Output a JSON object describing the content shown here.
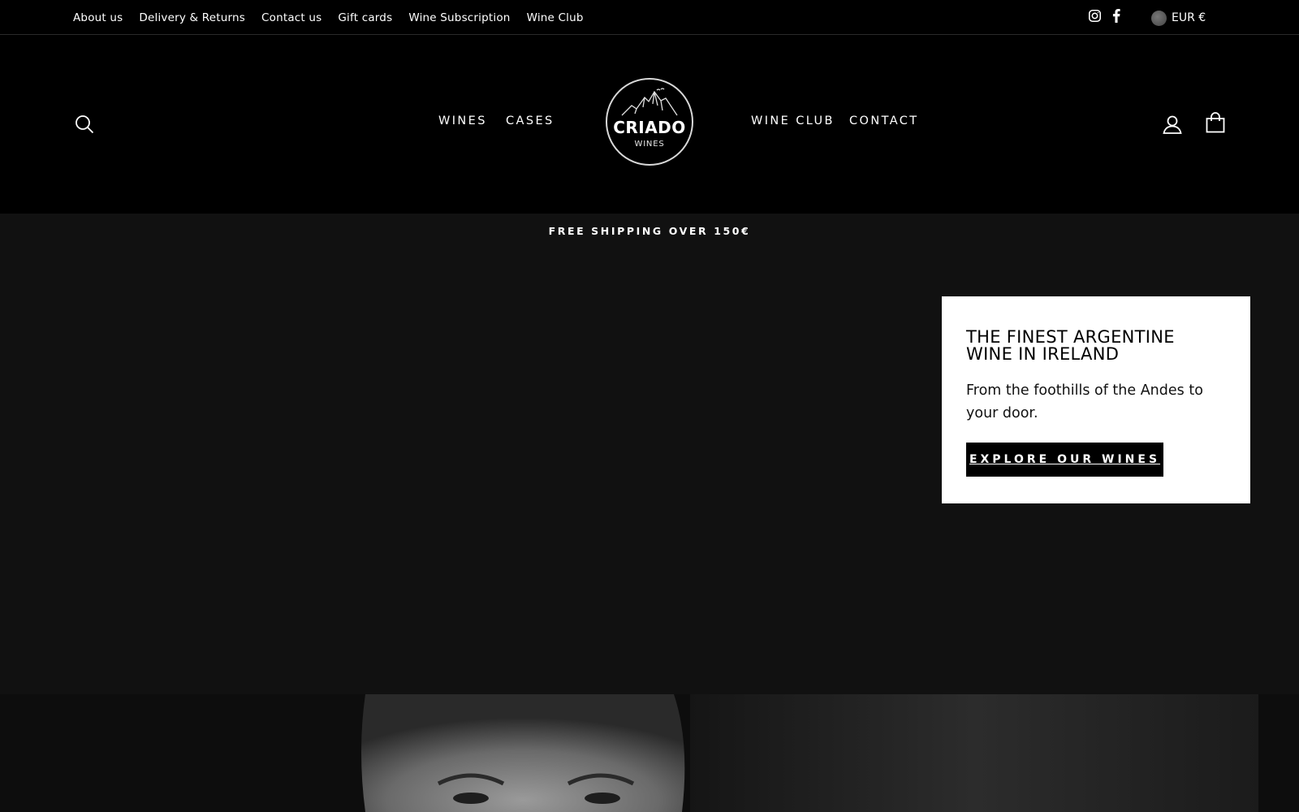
{
  "topbar": {
    "links": [
      "About us",
      "Delivery & Returns",
      "Contact us",
      "Gift cards",
      "Wine Subscription",
      "Wine Club"
    ],
    "social": [
      "instagram-icon",
      "facebook-icon"
    ],
    "currency": "EUR €"
  },
  "header": {
    "nav_left": [
      "WINES",
      "CASES"
    ],
    "nav_right": [
      "WINE CLUB",
      "CONTACT"
    ],
    "logo": {
      "title": "CRIADO",
      "subtitle": "WINES"
    },
    "icons": [
      "search-icon",
      "account-icon",
      "cart-icon"
    ]
  },
  "announcement": {
    "text": "FREE SHIPPING OVER 150€"
  },
  "promo": {
    "title": "THE FINEST ARGENTINE WINE IN IRELAND",
    "text": "From the foothills of the Andes to your door.",
    "button": "EXPLORE OUR WINES"
  },
  "colors": {
    "topbar_bg": "#000000",
    "page_bg": "#111111",
    "card_bg": "#ffffff",
    "accent": "#000000"
  }
}
